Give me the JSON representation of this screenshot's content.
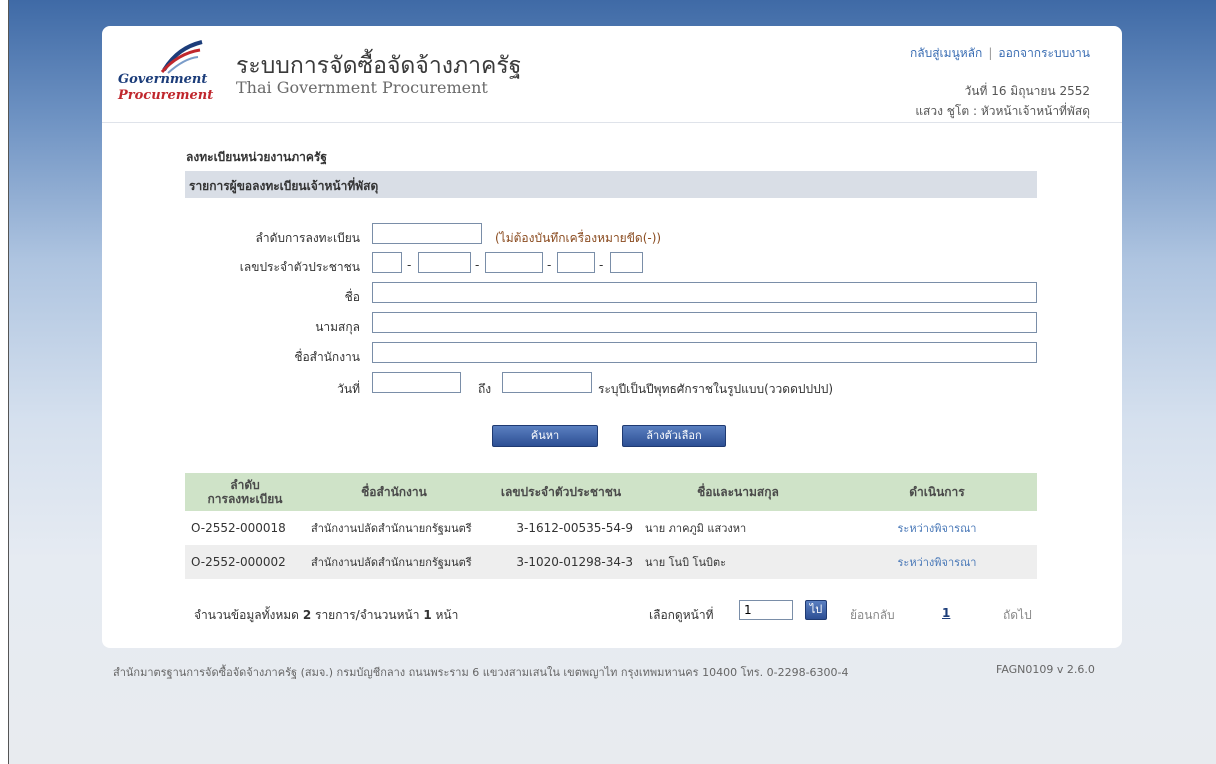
{
  "header": {
    "logo_line1": "Government",
    "logo_line2": "Procurement",
    "title_th": "ระบบการจัดซื้อจัดจ้างภาครัฐ",
    "title_en": "Thai Government Procurement",
    "link_main_menu": "กลับสู่เมนูหลัก",
    "link_separator": "|",
    "link_logout": "ออกจากระบบงาน",
    "date_text": "วันที่ 16 มิถุนายน 2552",
    "user_text": "แสวง ชูโต : หัวหน้าเจ้าหน้าที่พัสดุ"
  },
  "page": {
    "section_title": "ลงทะเบียนหน่วยงานภาครัฐ",
    "subsection_title": "รายการผู้ขอลงทะเบียนเจ้าหน้าที่พัสดุ"
  },
  "form": {
    "reg_no_label": "ลำดับการลงทะเบียน",
    "reg_no_value": "",
    "reg_no_hint": "(ไม่ต้องบันทึกเครื่องหมายขีด(-))",
    "id_label": "เลขประจำตัวประชาชน",
    "id_parts": [
      "",
      "",
      "",
      "",
      ""
    ],
    "dash": "-",
    "first_name_label": "ชื่อ",
    "first_name_value": "",
    "last_name_label": "นามสกุล",
    "last_name_value": "",
    "office_label": "ชื่อสำนักงาน",
    "office_value": "",
    "date_label": "วันที่",
    "date_from_value": "",
    "date_to_label": "ถึง",
    "date_to_value": "",
    "date_hint": "ระบุปีเป็นปีพุทธศักราชในรูปแบบ(ววดดปปปป)",
    "search_button": "ค้นหา",
    "clear_button": "ล้างตัวเลือก"
  },
  "table": {
    "headers": [
      "ลำดับ\nการลงทะเบียน",
      "ชื่อสำนักงาน",
      "เลขประจำตัวประชาชน",
      "ชื่อและนามสกุล",
      "ดำเนินการ"
    ],
    "rows": [
      {
        "reg_no": "O-2552-000018",
        "office": "สำนักงานปลัดสำนักนายกรัฐมนตรี",
        "id": "3-1612-00535-54-9",
        "name": "นาย ภาคภูมิ แสวงหา",
        "action": "ระหว่างพิจารณา"
      },
      {
        "reg_no": "O-2552-000002",
        "office": "สำนักงานปลัดสำนักนายกรัฐมนตรี",
        "id": "3-1020-01298-34-3",
        "name": "นาย โนบิ โนบิตะ",
        "action": "ระหว่างพิจารณา"
      }
    ]
  },
  "pager": {
    "total_prefix": "จำนวนข้อมูลทั้งหมด",
    "total_count": "2",
    "total_mid": "รายการ/จำนวนหน้า",
    "page_count": "1",
    "total_suffix": "หน้า",
    "goto_label": "เลือกดูหน้าที่",
    "goto_value": "1",
    "go_button": "ไป",
    "back_label": "ย้อนกลับ",
    "current_page": "1",
    "next_label": "ถัดไป"
  },
  "footer": {
    "address": "สำนักมาตรฐานการจัดซื้อจัดจ้างภาครัฐ (สมจ.) กรมบัญชีกลาง ถนนพระราม 6 แขวงสามเสนใน เขตพญาไท กรุงเทพมหานคร 10400 โทร. 0-2298-6300-4",
    "version": "FAGN0109 v 2.6.0"
  }
}
